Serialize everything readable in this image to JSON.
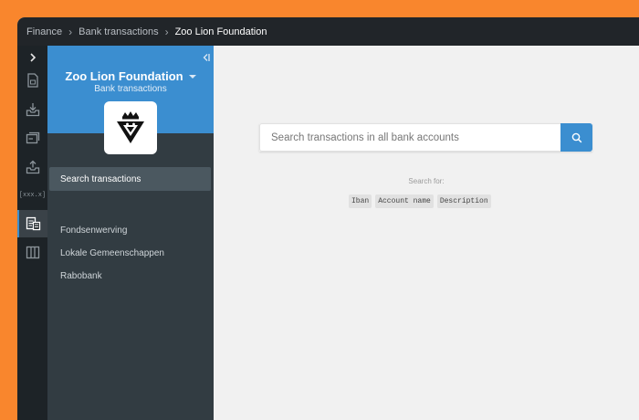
{
  "breadcrumb": {
    "items": [
      "Finance",
      "Bank transactions",
      "Zoo Lion Foundation"
    ],
    "separator": "›"
  },
  "rail": {
    "toggle_icon": "chevron-right-icon",
    "items": [
      {
        "icon": "document-icon"
      },
      {
        "icon": "inbox-download-icon"
      },
      {
        "icon": "cards-icon"
      },
      {
        "icon": "outbox-upload-icon"
      },
      {
        "icon": "iban-brackets-icon",
        "label": "[xxx.x]"
      },
      {
        "icon": "bank-transactions-icon",
        "active": true
      },
      {
        "icon": "columns-icon"
      }
    ]
  },
  "panel": {
    "title": "Zoo Lion Foundation",
    "subtitle": "Bank transactions",
    "logo": "lion-crown-logo",
    "active_item": "Search transactions",
    "items": [
      "Fondsenwerving",
      "Lokale Gemeenschappen",
      "Rabobank"
    ]
  },
  "main": {
    "search_placeholder": "Search transactions in all bank accounts",
    "search_for_label": "Search for:",
    "chips": [
      "Iban",
      "Account name",
      "Description"
    ]
  },
  "colors": {
    "accent": "#3b8ed0",
    "frame": "#f9862d",
    "topbar": "#212529",
    "panel": "#323c42"
  }
}
